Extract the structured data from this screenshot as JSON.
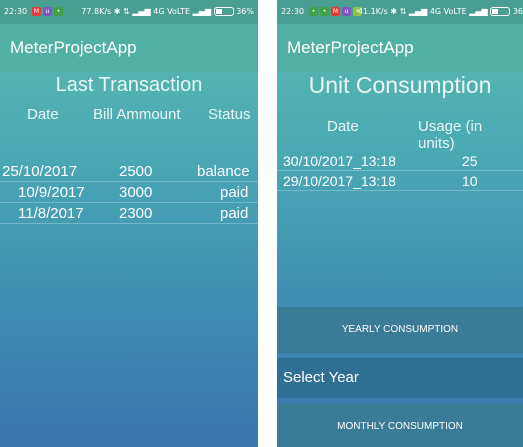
{
  "left": {
    "status": {
      "time": "22:30",
      "speed": "77.8K/s",
      "network": "4G VoLTE",
      "battery": "36%"
    },
    "app_title": "MeterProjectApp",
    "section_title": "Last Transaction",
    "columns": [
      "Date",
      "Bill Ammount",
      "Status"
    ],
    "rows": [
      {
        "date": "25/10/2017",
        "amount": "2500",
        "status": "balance"
      },
      {
        "date": "10/9/2017",
        "amount": "3000",
        "status": "paid"
      },
      {
        "date": "11/8/2017",
        "amount": "2300",
        "status": "paid"
      }
    ]
  },
  "right": {
    "status": {
      "time": "22:30",
      "speed": "41.1K/s",
      "network": "4G VoLTE",
      "battery": "36"
    },
    "app_title": "MeterProjectApp",
    "section_title": "Unit Consumption",
    "columns": [
      "Date",
      "Usage (in units)"
    ],
    "rows": [
      {
        "date": "30/10/2017_13:18",
        "usage": "25"
      },
      {
        "date": "29/10/2017_13:18",
        "usage": "10"
      }
    ],
    "yearly_button": "YEARLY CONSUMPTION",
    "select_year": "Select Year",
    "monthly_button": "MONTHLY CONSUMPTION"
  },
  "colors": {
    "accent": "#52b0a3",
    "statusbar": "#4a9e91",
    "button": "#3a7b95"
  }
}
